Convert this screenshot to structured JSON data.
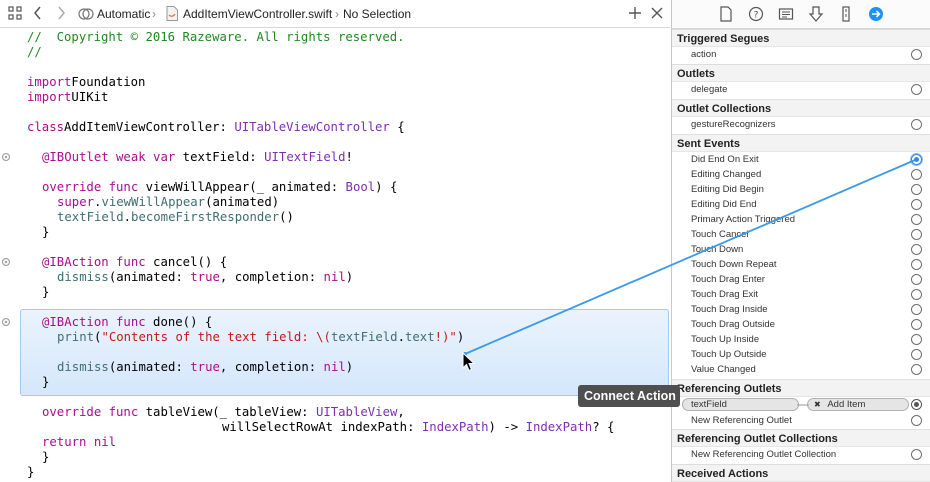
{
  "jumpbar": {
    "scheme": "Automatic",
    "file": "AddItemViewController.swift",
    "selection": "No Selection",
    "separator": "›"
  },
  "code": {
    "lines": [
      [
        [
          "cmt",
          "//  Copyright © 2016 Razeware. All rights reserved."
        ]
      ],
      [
        [
          "cmt",
          "//"
        ]
      ],
      [],
      [
        [
          "kw",
          "import"
        ],
        [
          "",
          "Foundation"
        ]
      ],
      [
        [
          "kw",
          "import"
        ],
        [
          "",
          "UIKit"
        ]
      ],
      [],
      [
        [
          "kw",
          "class"
        ],
        [
          "",
          "AddItemViewController: "
        ],
        [
          "ty",
          "UITableViewController"
        ],
        [
          "",
          " {"
        ]
      ],
      [],
      [
        [
          "",
          ""
        ],
        [
          "kw",
          "@IBOutlet weak var"
        ],
        [
          "",
          " textField: "
        ],
        [
          "ty",
          "UITextField"
        ],
        [
          "",
          "!"
        ]
      ],
      [],
      [
        [
          "kw",
          "override func"
        ],
        [
          "",
          " viewWillAppear(_ animated: "
        ],
        [
          "ty",
          "Bool"
        ],
        [
          "",
          ") {"
        ]
      ],
      [
        [
          "kw",
          "super"
        ],
        [
          "",
          "."
        ],
        [
          "fn",
          "viewWillAppear"
        ],
        [
          "",
          "(animated)"
        ]
      ],
      [
        [
          "fn",
          "textField"
        ],
        [
          "",
          "."
        ],
        [
          "fn",
          "becomeFirstResponder"
        ],
        [
          "",
          "()"
        ]
      ],
      [
        [
          "",
          "}"
        ]
      ],
      [],
      [
        [
          "kw",
          "@IBAction func"
        ],
        [
          "",
          " cancel() {"
        ]
      ],
      [
        [
          "fn",
          "dismiss"
        ],
        [
          "",
          "(animated: "
        ],
        [
          "kw",
          "true"
        ],
        [
          "",
          ", completion: "
        ],
        [
          "kw",
          "nil"
        ],
        [
          "",
          ")"
        ]
      ],
      [
        [
          "",
          "}"
        ]
      ],
      [],
      [
        [
          "kw",
          "@IBAction func"
        ],
        [
          "",
          " done() {"
        ]
      ],
      [
        [
          "fn",
          "print"
        ],
        [
          "",
          "("
        ],
        [
          "str",
          "\"Contents of the text field: \\("
        ],
        [
          "fn",
          "textField"
        ],
        [
          "",
          "."
        ],
        [
          "fn",
          "text"
        ],
        [
          "str",
          "!)\""
        ],
        [
          "",
          ")"
        ]
      ],
      [],
      [
        [
          "fn",
          "dismiss"
        ],
        [
          "",
          "(animated: "
        ],
        [
          "kw",
          "true"
        ],
        [
          "",
          ", completion: "
        ],
        [
          "kw",
          "nil"
        ],
        [
          "",
          ")"
        ]
      ],
      [
        [
          "",
          "}"
        ]
      ],
      [],
      [
        [
          "kw",
          "override func"
        ],
        [
          "",
          " tableView(_ tableView: "
        ],
        [
          "ty",
          "UITableView"
        ],
        [
          "",
          ","
        ]
      ],
      [
        [
          "",
          "willSelectRowAt indexPath: "
        ],
        [
          "ty",
          "IndexPath"
        ],
        [
          "",
          ") -> "
        ],
        [
          "ty",
          "IndexPath"
        ],
        [
          "",
          "? {"
        ]
      ],
      [
        [
          "kw",
          "return nil"
        ]
      ],
      [
        [
          "",
          "}"
        ]
      ],
      [
        [
          "",
          "}"
        ]
      ]
    ]
  },
  "inspector": {
    "triggered_segues": {
      "title": "Triggered Segues",
      "rows": [
        "action"
      ]
    },
    "outlets": {
      "title": "Outlets",
      "rows": [
        "delegate"
      ]
    },
    "outlet_collections": {
      "title": "Outlet Collections",
      "rows": [
        "gestureRecognizers"
      ]
    },
    "sent_events": {
      "title": "Sent Events",
      "rows": [
        "Did End On Exit",
        "Editing Changed",
        "Editing Did Begin",
        "Editing Did End",
        "Primary Action Triggered",
        "Touch Cancel",
        "Touch Down",
        "Touch Down Repeat",
        "Touch Drag Enter",
        "Touch Drag Exit",
        "Touch Drag Inside",
        "Touch Drag Outside",
        "Touch Up Inside",
        "Touch Up Outside",
        "Value Changed"
      ]
    },
    "referencing_outlets": {
      "title": "Referencing Outlets",
      "outlet_name": "textField",
      "target_x": "✖",
      "target_name": "Add Item",
      "new_row": "New Referencing Outlet"
    },
    "referencing_outlet_collections": {
      "title": "Referencing Outlet Collections",
      "new_row": "New Referencing Outlet Collection"
    },
    "received_actions": {
      "title": "Received Actions"
    }
  },
  "tooltip": "Connect Action",
  "colors": {
    "accent": "#1e90ff",
    "connection_line": "#3b9be8",
    "highlight": "#d8e9fb"
  }
}
